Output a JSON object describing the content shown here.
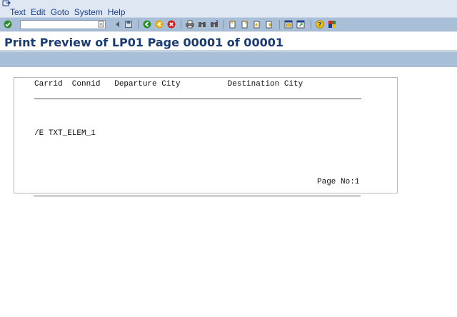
{
  "menu": {
    "items": [
      "Text",
      "Edit",
      "Goto",
      "System",
      "Help"
    ]
  },
  "toolbar": {
    "command_value": "",
    "colors": {
      "enter_green": "#2a8c2a",
      "back_green": "#2f8f2f",
      "exit_yellow": "#e0a800",
      "cancel_red": "#cc2222"
    },
    "icons": [
      "enter-icon",
      "save-icon",
      "back-icon",
      "exit-icon",
      "cancel-icon",
      "print-icon",
      "find-icon",
      "find-next-icon",
      "first-page-icon",
      "previous-page-icon",
      "next-page-icon",
      "last-page-icon",
      "create-session-icon",
      "shortcut-icon",
      "help-icon",
      "customize-layout-icon"
    ]
  },
  "title": "Print Preview of LP01 Page 00001 of 00001",
  "preview": {
    "header_line": "Carrid  Connid   Departure City          Destination City",
    "element_text": "/E TXT_ELEM_1",
    "footer_text": "Page No:1"
  }
}
